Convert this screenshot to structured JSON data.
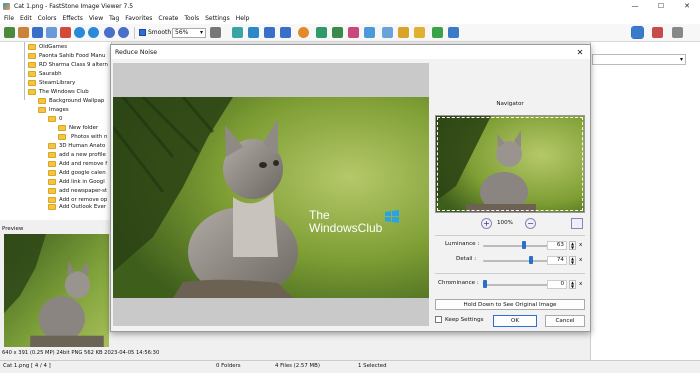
{
  "window": {
    "title": "Cat 1.png  -  FastStone Image Viewer 7.5"
  },
  "menu": [
    "File",
    "Edit",
    "Colors",
    "Effects",
    "View",
    "Tag",
    "Favorites",
    "Create",
    "Tools",
    "Settings",
    "Help"
  ],
  "toolbar": {
    "smooth_label": "Smooth",
    "zoom_value": "56%"
  },
  "tree": {
    "items": [
      {
        "label": "OldGames"
      },
      {
        "label": "Paonta Sahib Food Manu"
      },
      {
        "label": "RD Sharma Class 9 altern"
      },
      {
        "label": "Saurabh"
      },
      {
        "label": "SteamLibrary"
      },
      {
        "label": "The Windows Club"
      },
      {
        "label": "Background Wallpap"
      },
      {
        "label": "Images"
      },
      {
        "label": "0"
      },
      {
        "label": "New folder"
      },
      {
        "label": "Photos with n"
      },
      {
        "label": "3D Human Anato"
      },
      {
        "label": "add a new profile"
      },
      {
        "label": "Add and remove f"
      },
      {
        "label": "Add google calen"
      },
      {
        "label": "Add link in Googl"
      },
      {
        "label": "add newspaper-st"
      },
      {
        "label": "Add or remove op"
      },
      {
        "label": "Add Outlook Ever"
      }
    ]
  },
  "preview": {
    "title": "Preview",
    "info": "640 x 391 (0.25 MP)   24bit  PNG   562 KB   2023-04-05 14:56:30"
  },
  "status": {
    "file": "Cat 1.png [ 4 / 4 ]",
    "folders": "0 Folders",
    "files": "4 Files (2.57 MB)",
    "selected": "1 Selected"
  },
  "dialog": {
    "title": "Reduce Noise",
    "navigator_label": "Navigator",
    "zoom": "100%",
    "luminance": {
      "label": "Luminance :",
      "value": "63",
      "level": 0.63
    },
    "detail": {
      "label": "Detail :",
      "value": "74",
      "level": 0.74
    },
    "chrominance": {
      "label": "Chrominance :",
      "value": "0",
      "level": 0
    },
    "x_label": "x",
    "hold_label": "Hold Down to See Original Image",
    "keep_label": "Keep Settings",
    "ok_label": "OK",
    "cancel_label": "Cancel",
    "watermark_line1": "The",
    "watermark_line2": "WindowsClub"
  },
  "colors": {
    "accent": "#2f6fd1",
    "grass": "#5f7f2a",
    "selection": "#3d7fd1"
  }
}
